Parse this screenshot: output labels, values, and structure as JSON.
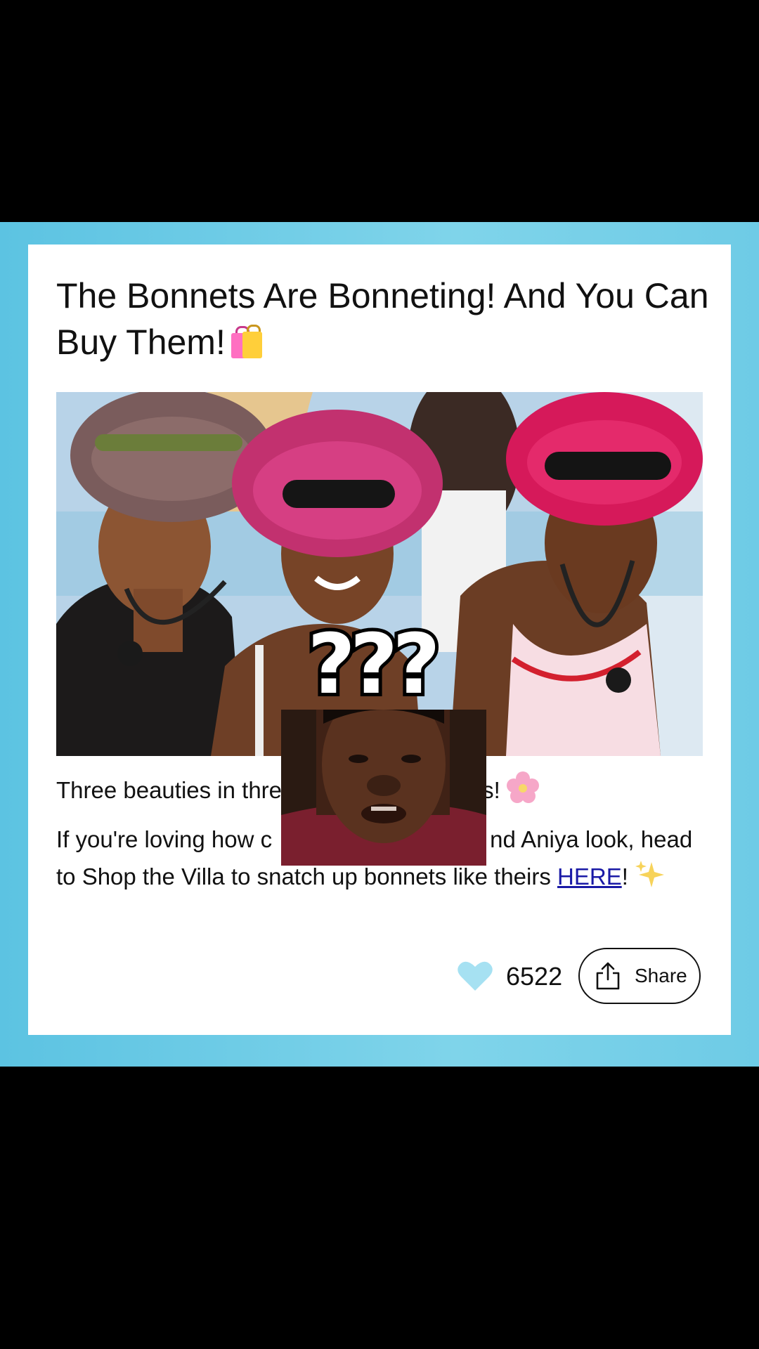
{
  "article": {
    "title": "The Bonnets Are Bonneting! And You Can Buy Them!",
    "title_icon": "shopping-bags-icon",
    "caption_left": "Three beauties in three b",
    "caption_right": "nnets!",
    "caption_icon": "cherry-blossom-icon",
    "body_line1_left": "If you're loving how c",
    "body_line1_right": "nd Aniya look, head",
    "body_line2": "to Shop the Villa to snatch up bonnets like theirs ",
    "link_text": "HERE",
    "after_link": "!",
    "end_icon": "sparkles-icon"
  },
  "overlay": {
    "text": "???"
  },
  "actions": {
    "like_count": "6522",
    "share_label": "Share"
  },
  "colors": {
    "frame": "#6ecbe6",
    "heart": "#a6e1f2",
    "link": "#1a1aa6"
  }
}
